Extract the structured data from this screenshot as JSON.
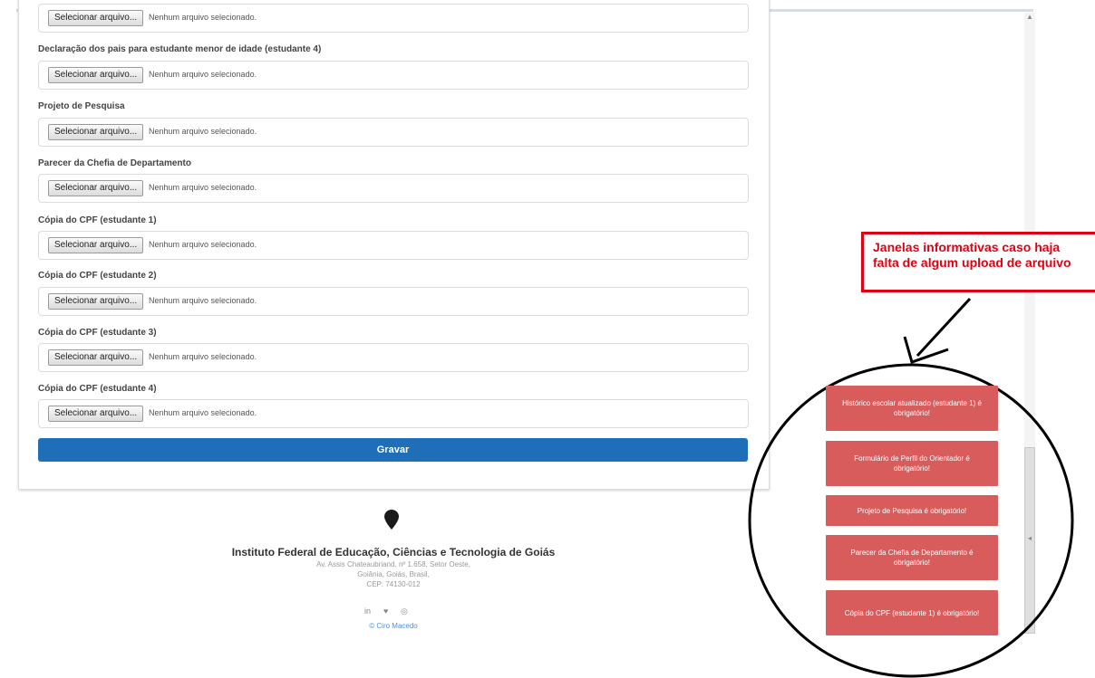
{
  "form": {
    "fields": [
      {
        "label": "",
        "button": "Selecionar arquivo...",
        "status": "Nenhum arquivo selecionado."
      },
      {
        "label": "Declaração dos pais para estudante menor de idade (estudante 4)",
        "button": "Selecionar arquivo...",
        "status": "Nenhum arquivo selecionado."
      },
      {
        "label": "Projeto de Pesquisa",
        "button": "Selecionar arquivo...",
        "status": "Nenhum arquivo selecionado."
      },
      {
        "label": "Parecer da Chefia de Departamento",
        "button": "Selecionar arquivo...",
        "status": "Nenhum arquivo selecionado."
      },
      {
        "label": "Cópia do CPF (estudante 1)",
        "button": "Selecionar arquivo...",
        "status": "Nenhum arquivo selecionado."
      },
      {
        "label": "Cópia do CPF (estudante 2)",
        "button": "Selecionar arquivo...",
        "status": "Nenhum arquivo selecionado."
      },
      {
        "label": "Cópia do CPF (estudante 3)",
        "button": "Selecionar arquivo...",
        "status": "Nenhum arquivo selecionado."
      },
      {
        "label": "Cópia do CPF (estudante 4)",
        "button": "Selecionar arquivo...",
        "status": "Nenhum arquivo selecionado."
      }
    ],
    "submit_label": "Gravar"
  },
  "footer": {
    "title": "Instituto Federal de Educação, Ciências e Tecnologia de Goiás",
    "address1": "Av. Assis Chateaubriand, nº 1.658, Setor Oeste,",
    "address2": "Goiânia, Goiás, Brasil,",
    "address3": "CEP: 74130-012",
    "social_icons": [
      "linkedin-icon",
      "twitter-icon",
      "instagram-icon"
    ],
    "social_glyphs": [
      "in",
      "♥",
      "◎"
    ],
    "credit": "© Ciro Macedo"
  },
  "annotation": {
    "line1": "Janelas informativas caso haja",
    "line2": "falta de algum upload de arquivo"
  },
  "alerts": [
    "Histórico escolar atualizado (estudante 1) é obrigatório!",
    "Formulário de Perfil do Orientador é obrigatório!",
    "Projeto de Pesquisa é obrigatório!",
    "Parecer da Chefia de Departamento é obrigatório!",
    "Cópia do CPF (estudante 1) é obrigatório!"
  ],
  "colors": {
    "primary": "#1f6fb8",
    "alert": "#d95c5c",
    "annotation": "#e00012"
  }
}
